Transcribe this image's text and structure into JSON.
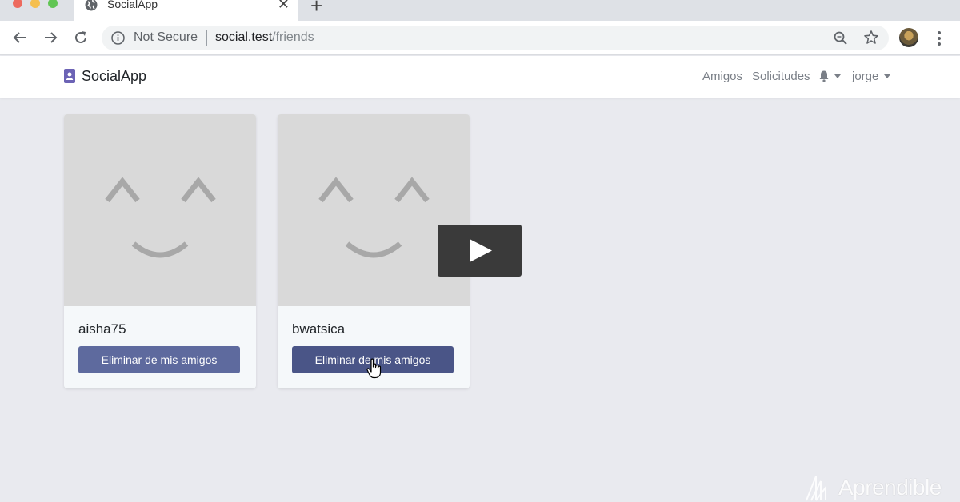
{
  "browser": {
    "tab_title": "SocialApp",
    "security_label": "Not Secure",
    "url_host": "social.test",
    "url_path": "/friends"
  },
  "navbar": {
    "brand": "SocialApp",
    "links": [
      "Amigos",
      "Solicitudes"
    ],
    "user": "jorge"
  },
  "friends": [
    {
      "username": "aisha75",
      "button_label": "Eliminar de mis amigos"
    },
    {
      "username": "bwatsica",
      "button_label": "Eliminar de mis amigos"
    }
  ],
  "colors": {
    "button": "#5e6a9e",
    "button_hover": "#4a5587",
    "brand_icon": "#6c63b5"
  },
  "watermark": "Aprendible",
  "icons": [
    "globe-icon",
    "close-icon",
    "plus-icon",
    "back-arrow-icon",
    "forward-arrow-icon",
    "reload-icon",
    "info-icon",
    "zoom-icon",
    "star-icon",
    "menu-dots-icon",
    "contact-book-icon",
    "bell-icon",
    "play-icon",
    "hand-cursor-icon"
  ]
}
